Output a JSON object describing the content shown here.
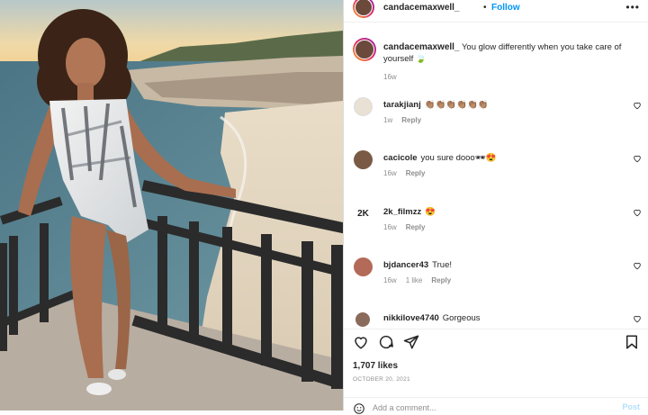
{
  "post": {
    "author": "candacemaxwell_",
    "dot": "•",
    "follow_label": "Follow",
    "more_icon": "more-options-icon",
    "photo_description_icon": "post-photo",
    "caption": {
      "text": "You glow differently when you take care of yourself",
      "emoji": "🍃",
      "time": "16w"
    },
    "comments": [
      {
        "user": "tarakjianj",
        "text": "👏🏽👏🏽👏🏽👏🏽👏🏽👏🏽",
        "time": "1w",
        "reply": "Reply",
        "likes": "",
        "avatar_color": "#e9e1d4"
      },
      {
        "user": "cacicole",
        "text": "you sure dooo🕶😍",
        "time": "16w",
        "reply": "Reply",
        "likes": "",
        "avatar_color": "#7a5a45"
      },
      {
        "user": "2k_filmzz",
        "text": "😍",
        "time": "16w",
        "reply": "Reply",
        "likes": "",
        "avatar_color": "#222222"
      },
      {
        "user": "bjdancer43",
        "text": "True!",
        "time": "16w",
        "reply": "Reply",
        "likes": "1 like",
        "avatar_color": "#b46a58"
      },
      {
        "user": "nikkilove4740",
        "text": "Gorgeous",
        "time": "",
        "reply": "",
        "likes": "",
        "avatar_color": "#8a6a5a"
      }
    ],
    "likes": "1,707 likes",
    "date": "OCTOBER 20, 2021",
    "add_comment_placeholder": "Add a comment...",
    "post_button": "Post"
  },
  "colors": {
    "link_blue": "#0095f6",
    "text": "#262626",
    "muted": "#8e8e8e"
  }
}
